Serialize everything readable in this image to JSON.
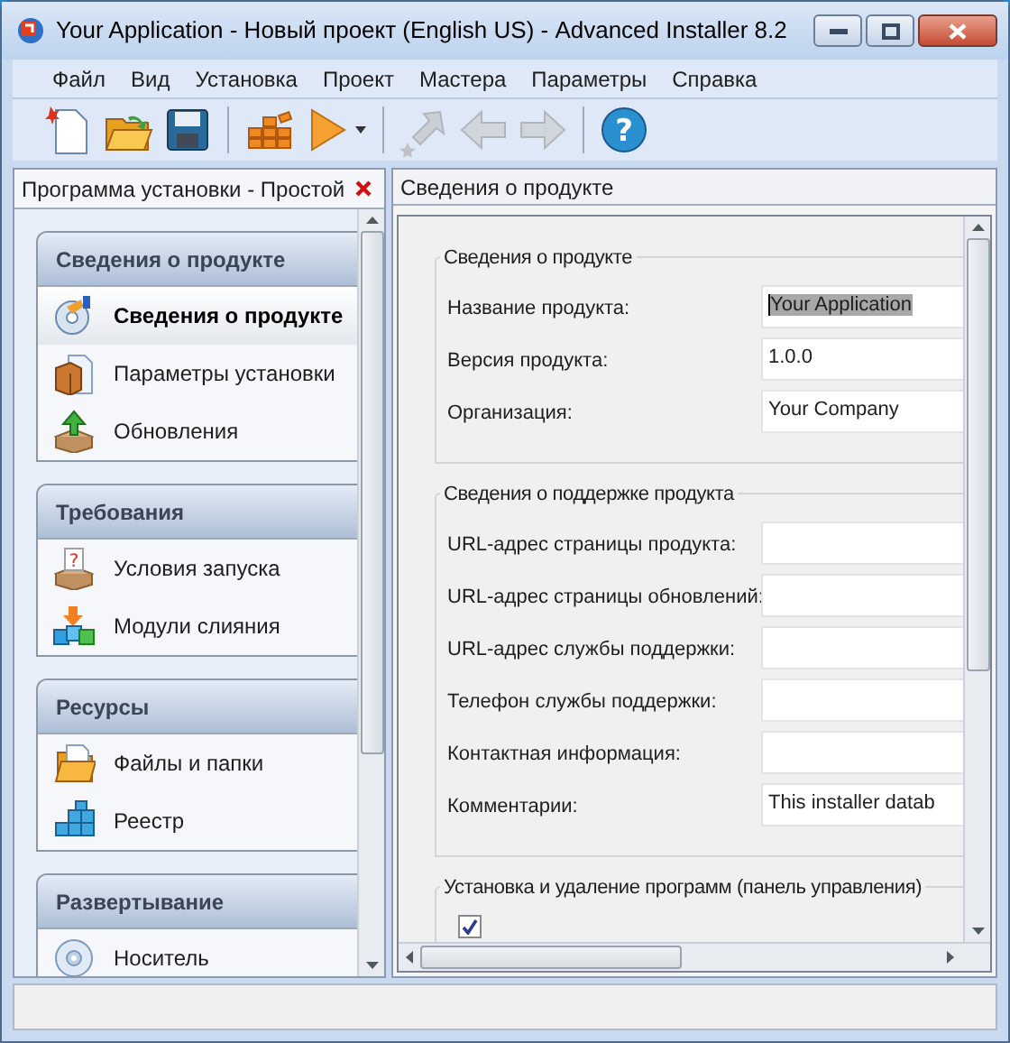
{
  "window": {
    "title": "Your Application - Новый проект (English US) - Advanced Installer 8.2"
  },
  "menu": [
    "Файл",
    "Вид",
    "Установка",
    "Проект",
    "Мастера",
    "Параметры",
    "Справка"
  ],
  "toolbar": [
    {
      "kind": "new",
      "disabled": false
    },
    {
      "kind": "open",
      "disabled": false
    },
    {
      "kind": "save",
      "disabled": false
    },
    {
      "kind": "separator"
    },
    {
      "kind": "build",
      "disabled": false
    },
    {
      "kind": "run",
      "disabled": false
    },
    {
      "kind": "separator"
    },
    {
      "kind": "goto",
      "disabled": true
    },
    {
      "kind": "back",
      "disabled": true
    },
    {
      "kind": "forward",
      "disabled": true
    },
    {
      "kind": "separator"
    },
    {
      "kind": "help",
      "disabled": false,
      "glyph": "?"
    }
  ],
  "left_pane": {
    "title": "Программа установки - Простой",
    "groups": [
      {
        "title": "Сведения о продукте",
        "items": [
          {
            "label": "Сведения о продукте",
            "kind": "disc",
            "selected": true
          },
          {
            "label": "Параметры установки",
            "kind": "box",
            "selected": false
          },
          {
            "label": "Обновления",
            "kind": "box-up",
            "selected": false
          }
        ]
      },
      {
        "title": "Требования",
        "items": [
          {
            "label": "Условия запуска",
            "kind": "box-question",
            "glyph": "?",
            "selected": false
          },
          {
            "label": "Модули слияния",
            "kind": "cubes",
            "selected": false
          }
        ]
      },
      {
        "title": "Ресурсы",
        "items": [
          {
            "label": "Файлы и папки",
            "kind": "folder",
            "selected": false
          },
          {
            "label": "Реестр",
            "kind": "registry",
            "selected": false
          }
        ]
      },
      {
        "title": "Развертывание",
        "items": [
          {
            "label": "Носитель",
            "kind": "media",
            "selected": false
          }
        ]
      }
    ]
  },
  "right_pane": {
    "title": "Сведения о продукте",
    "sections": [
      {
        "title": "Сведения о продукте",
        "fields": [
          {
            "label": "Название продукта:",
            "value": "Your Application",
            "text_selected": true
          },
          {
            "label": "Версия продукта:",
            "value": "1.0.0",
            "text_selected": false
          },
          {
            "label": "Организация:",
            "value": "Your Company",
            "text_selected": false
          }
        ]
      },
      {
        "title": "Сведения о поддержке продукта",
        "fields": [
          {
            "label": "URL-адрес страницы продукта:"
          },
          {
            "label": "URL-адрес страницы обновлений:"
          },
          {
            "label": "URL-адрес службы поддержки:"
          },
          {
            "label": "Телефон службы поддержки:"
          },
          {
            "label": "Контактная информация:"
          },
          {
            "label": "Комментарии:",
            "value": "This installer datab",
            "text_selected": false
          }
        ]
      },
      {
        "title": "Установка и удаление программ (панель управления)",
        "checkboxes": [
          {
            "checked": true
          }
        ]
      }
    ]
  }
}
